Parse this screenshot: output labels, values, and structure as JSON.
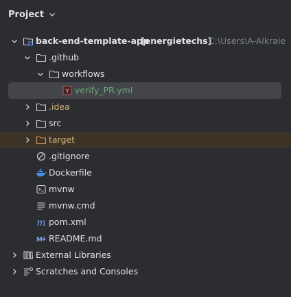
{
  "panel": {
    "title": "Project"
  },
  "tree": {
    "root": {
      "name": "back-end-template-app",
      "module": "[energietechs]",
      "path": "C:\\Users\\A-Alkraie"
    },
    "github": "​.github",
    "workflows": "workflows",
    "verify": "verify_PR.yml",
    "idea": ".idea",
    "src": "src",
    "target": "target",
    "gitignore": ".gitignore",
    "dockerfile": "Dockerfile",
    "mvnw": "mvnw",
    "mvnw_cmd": "mvnw.cmd",
    "pom": "pom.xml",
    "readme": "README.md",
    "external": "External Libraries",
    "scratches": "Scratches and Consoles"
  },
  "colors": {
    "background": "#2b2d30",
    "selection": "#43454a",
    "excluded_row": "#3c3225",
    "folder_icon": "#ced0d6",
    "yaml_icon": "#c94f4f",
    "docker_icon": "#4a8fe0",
    "markdown_icon": "#7aa2f7",
    "vcs_added_green": "#6aab73",
    "ignored_gold": "#d5b778",
    "excluded_orange": "#d19a66"
  }
}
